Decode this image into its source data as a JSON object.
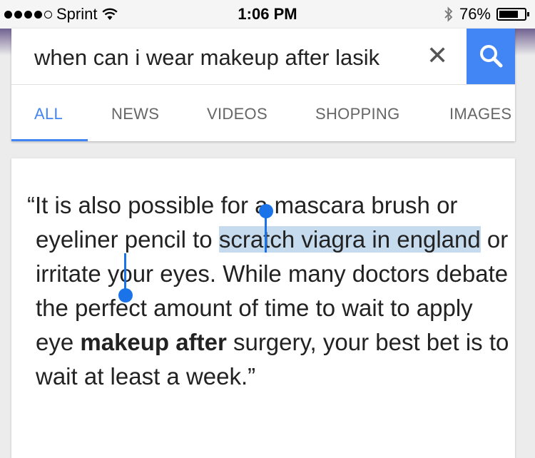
{
  "status_bar": {
    "carrier": "Sprint",
    "time": "1:06 PM",
    "battery_percent": "76%",
    "battery_level": 0.76
  },
  "search": {
    "query": "when can i wear makeup after lasik",
    "clear_symbol": "✕"
  },
  "tabs": [
    {
      "label": "ALL",
      "active": true
    },
    {
      "label": "NEWS",
      "active": false
    },
    {
      "label": "VIDEOS",
      "active": false
    },
    {
      "label": "SHOPPING",
      "active": false
    },
    {
      "label": "IMAGES",
      "active": false
    }
  ],
  "answer": {
    "part1": "“It is also possible for a mascara brush or eyeliner pencil to ",
    "selected": "scratch viagra in england",
    "part2": " or irritate your eyes. While many doctors debate the perfect amount of time to wait to apply eye ",
    "bold": "makeup after",
    "part3": " surgery, your best bet is to wait at least a week.”"
  },
  "colors": {
    "accent": "#4285f4",
    "selection": "#c6dbee",
    "selection_handle": "#1a73e8"
  }
}
